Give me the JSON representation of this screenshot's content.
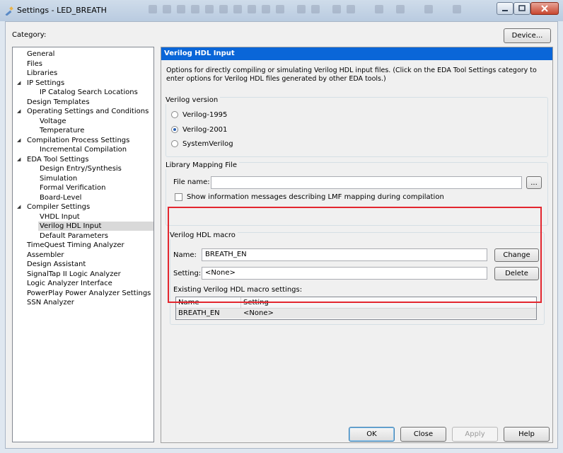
{
  "window": {
    "title": "Settings - LED_BREATH"
  },
  "header": {
    "category_label": "Category:",
    "device_button": "Device..."
  },
  "tree": {
    "items": [
      {
        "label": "General",
        "level": 0,
        "expandable": false
      },
      {
        "label": "Files",
        "level": 0,
        "expandable": false
      },
      {
        "label": "Libraries",
        "level": 0,
        "expandable": false
      },
      {
        "label": "IP Settings",
        "level": 0,
        "expandable": true
      },
      {
        "label": "IP Catalog Search Locations",
        "level": 1,
        "expandable": false
      },
      {
        "label": "Design Templates",
        "level": 0,
        "expandable": false
      },
      {
        "label": "Operating Settings and Conditions",
        "level": 0,
        "expandable": true
      },
      {
        "label": "Voltage",
        "level": 1,
        "expandable": false
      },
      {
        "label": "Temperature",
        "level": 1,
        "expandable": false
      },
      {
        "label": "Compilation Process Settings",
        "level": 0,
        "expandable": true
      },
      {
        "label": "Incremental Compilation",
        "level": 1,
        "expandable": false
      },
      {
        "label": "EDA Tool Settings",
        "level": 0,
        "expandable": true
      },
      {
        "label": "Design Entry/Synthesis",
        "level": 1,
        "expandable": false
      },
      {
        "label": "Simulation",
        "level": 1,
        "expandable": false
      },
      {
        "label": "Formal Verification",
        "level": 1,
        "expandable": false
      },
      {
        "label": "Board-Level",
        "level": 1,
        "expandable": false
      },
      {
        "label": "Compiler Settings",
        "level": 0,
        "expandable": true
      },
      {
        "label": "VHDL Input",
        "level": 1,
        "expandable": false
      },
      {
        "label": "Verilog HDL Input",
        "level": 1,
        "expandable": false,
        "selected": true
      },
      {
        "label": "Default Parameters",
        "level": 1,
        "expandable": false
      },
      {
        "label": "TimeQuest Timing Analyzer",
        "level": 0,
        "expandable": false
      },
      {
        "label": "Assembler",
        "level": 0,
        "expandable": false
      },
      {
        "label": "Design Assistant",
        "level": 0,
        "expandable": false
      },
      {
        "label": "SignalTap II Logic Analyzer",
        "level": 0,
        "expandable": false
      },
      {
        "label": "Logic Analyzer Interface",
        "level": 0,
        "expandable": false
      },
      {
        "label": "PowerPlay Power Analyzer Settings",
        "level": 0,
        "expandable": false
      },
      {
        "label": "SSN Analyzer",
        "level": 0,
        "expandable": false
      }
    ]
  },
  "panel": {
    "header": "Verilog HDL Input",
    "description": "Options for directly compiling or simulating Verilog HDL input files.  (Click on the EDA Tool Settings category to enter options for Verilog HDL files generated by other EDA tools.)",
    "version_group": {
      "title": "Verilog version",
      "options": [
        {
          "label": "Verilog-1995",
          "selected": false
        },
        {
          "label": "Verilog-2001",
          "selected": true
        },
        {
          "label": "SystemVerilog",
          "selected": false
        }
      ]
    },
    "library_group": {
      "title": "Library Mapping File",
      "file_name_label": "File name:",
      "file_name_value": "",
      "browse_button": "...",
      "show_info_label": "Show information messages describing LMF mapping during compilation",
      "show_info_checked": false
    },
    "macro_group": {
      "title": "Verilog HDL macro",
      "name_label": "Name:",
      "name_value": "BREATH_EN",
      "change_button": "Change",
      "setting_label": "Setting:",
      "setting_value": "<None>",
      "delete_button": "Delete",
      "existing_label": "Existing Verilog HDL macro settings:",
      "table": {
        "columns": [
          "Name",
          "Setting"
        ],
        "rows": [
          {
            "name": "BREATH_EN",
            "setting": "<None>"
          }
        ]
      }
    }
  },
  "footer": {
    "ok": "OK",
    "close": "Close",
    "apply": "Apply",
    "help": "Help"
  },
  "colors": {
    "panel_header_bg": "#0a66d8",
    "highlight_border": "#e3262e"
  }
}
